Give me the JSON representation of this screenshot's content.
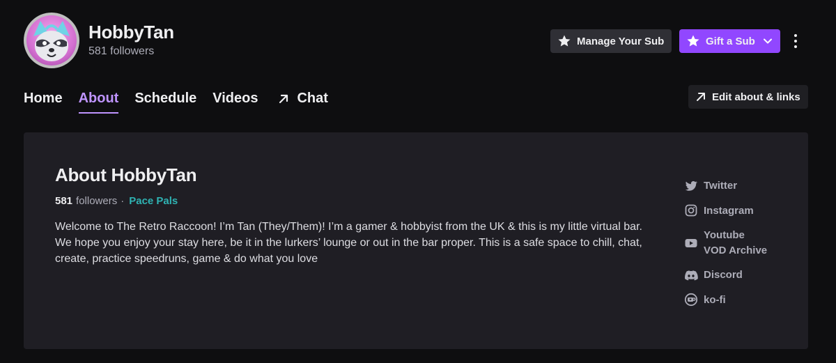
{
  "channel": {
    "name": "HobbyTan",
    "followers_label": "581 followers"
  },
  "header": {
    "manage_sub_label": "Manage Your Sub",
    "gift_sub_label": "Gift a Sub",
    "accent_color": "#9147ff"
  },
  "nav": {
    "items": [
      {
        "label": "Home",
        "active": false
      },
      {
        "label": "About",
        "active": true
      },
      {
        "label": "Schedule",
        "active": false
      },
      {
        "label": "Videos",
        "active": false
      },
      {
        "label": "Chat",
        "active": false,
        "icon": "arrow-up-right-icon"
      }
    ],
    "edit_label": "Edit about & links"
  },
  "about": {
    "title": "About HobbyTan",
    "followers_count": "581",
    "followers_word": "followers",
    "separator": "·",
    "team": "Pace Pals",
    "bio": "Welcome to The Retro Raccoon! I’m Tan (They/Them)! I’m a gamer & hobbyist from the UK & this is my little virtual bar. We hope you enjoy your stay here, be it in the lurkers’ lounge or out in the bar proper. This is a safe space to chill, chat, create, practice speedruns, game & do what you love"
  },
  "links": [
    {
      "label": "Twitter",
      "icon": "twitter-icon"
    },
    {
      "label": "Instagram",
      "icon": "instagram-icon"
    },
    {
      "label": "Youtube VOD Archive",
      "icon": "youtube-icon"
    },
    {
      "label": "Discord",
      "icon": "discord-icon"
    },
    {
      "label": "ko-fi",
      "icon": "kofi-icon"
    }
  ]
}
